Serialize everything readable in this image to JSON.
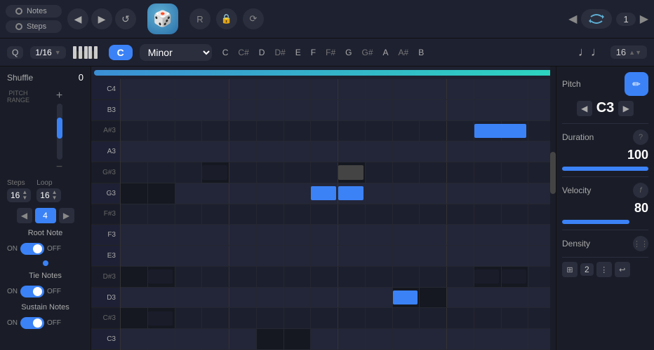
{
  "topbar": {
    "notes_btn": "Notes",
    "steps_btn": "Steps",
    "arrow_left": "◀",
    "arrow_right": "▶",
    "arrow_back": "↺",
    "loop_count": "1",
    "actions": [
      "R",
      "🔒",
      "⟳"
    ]
  },
  "secondbar": {
    "scale": "Minor",
    "root_note": "C",
    "quantize": "Q",
    "quantize_value": "1/16",
    "measure_value": "16",
    "notes": [
      "C",
      "C#",
      "D",
      "D#",
      "E",
      "F",
      "F#",
      "G",
      "G#",
      "A",
      "A#",
      "B"
    ]
  },
  "leftpanel": {
    "shuffle_label": "Shuffle",
    "shuffle_value": "0",
    "steps_label": "Steps",
    "loop_label": "Loop",
    "steps_value": "16",
    "loop_value": "16",
    "nav_value": "4",
    "root_note_label": "Root Note",
    "root_on": "ON",
    "root_off": "OFF",
    "tie_notes_label": "Tie Notes",
    "tie_on": "ON",
    "tie_off": "OFF",
    "sustain_notes_label": "Sustain Notes",
    "sustain_on": "ON",
    "sustain_off": "OFF",
    "pitch_range_label": "PITCH\nRANGE"
  },
  "rightpanel": {
    "pitch_label": "Pitch",
    "pitch_value": "C3",
    "duration_label": "Duration",
    "duration_value": "100",
    "velocity_label": "Velocity",
    "velocity_value": "80",
    "density_label": "Density",
    "bottom_value": "2"
  },
  "grid": {
    "notes": [
      "C4",
      "B3",
      "A#3",
      "A3",
      "G#3",
      "G3",
      "F#3",
      "F3",
      "E3",
      "D#3",
      "D3",
      "C#3",
      "C3"
    ],
    "black_notes": [
      "A#3",
      "G#3",
      "F#3",
      "D#3",
      "C#3"
    ],
    "white_notes": [
      "C4",
      "B3",
      "A3",
      "G3",
      "F3",
      "E3",
      "D3",
      "C3"
    ],
    "cells": 16
  }
}
